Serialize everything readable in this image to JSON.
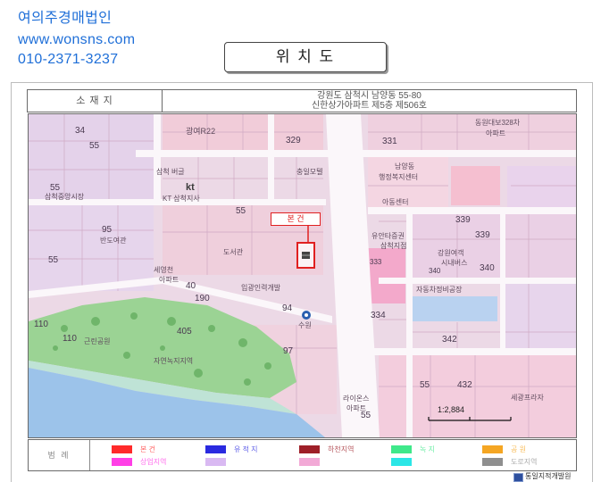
{
  "watermark": {
    "name": "여의주경매법인",
    "url": "www.wonsns.com",
    "phone": "010-2371-3237",
    "color": "#1f6fd8"
  },
  "title": "위 치 도",
  "location": {
    "label": "소 재 지",
    "address_line1": "강원도 삼척시 남양동 55-80",
    "address_line2": "신한상가아파트 제5층 제506호"
  },
  "map": {
    "subject_label": "본 건",
    "subject_color": "#e02020",
    "scale": "1:2,884",
    "labels": [
      "34",
      "55",
      "광여R22",
      "329",
      "331",
      "동원대보328차",
      "아파트",
      "삼척 버글",
      "충일모텔",
      "kt",
      "KT 삼척지사",
      "55",
      "삼척중앙시장",
      "55",
      "남양동",
      "행정복지센터",
      "아동센터",
      "339",
      "339",
      "유안타증권",
      "삼척지점",
      "333",
      "강원여객",
      "시내버스",
      "340",
      "340",
      "95",
      "반도여관",
      "55",
      "도서관",
      "세영천",
      "아파트",
      "40",
      "190",
      "입광인력개발",
      "94",
      "수원",
      "334",
      "자동차정비공장",
      "342",
      "110",
      "110",
      "근린공원",
      "405",
      "97",
      "자연녹지지역",
      "55",
      "432",
      "세광프라자",
      "55",
      "라이온스",
      "아파트"
    ]
  },
  "legend": {
    "title": "범 례",
    "items": [
      {
        "label": "본 건",
        "color": "#ff2a2a"
      },
      {
        "label": "유 적 지",
        "color": "#2a2ae0"
      },
      {
        "label": "하천지역",
        "color": "#9e1f28"
      },
      {
        "label": "녹 지",
        "color": "#3fe88a"
      },
      {
        "label": "공 원",
        "color": "#f5a623"
      },
      {
        "label": "상업지역",
        "color": "#ff3fe6"
      },
      {
        "label": "",
        "color": "#d9b9f2"
      },
      {
        "label": "",
        "color": "#f2a9d6"
      },
      {
        "label": "",
        "color": "#2be6e6"
      },
      {
        "label": "도로지역",
        "color": "#8f8f8f"
      }
    ]
  },
  "copyright": "통일지적개발원",
  "icons": {
    "subject": "building-icon",
    "bus_stop": "bus-stop-icon",
    "logo": "cadastral-logo-icon"
  }
}
